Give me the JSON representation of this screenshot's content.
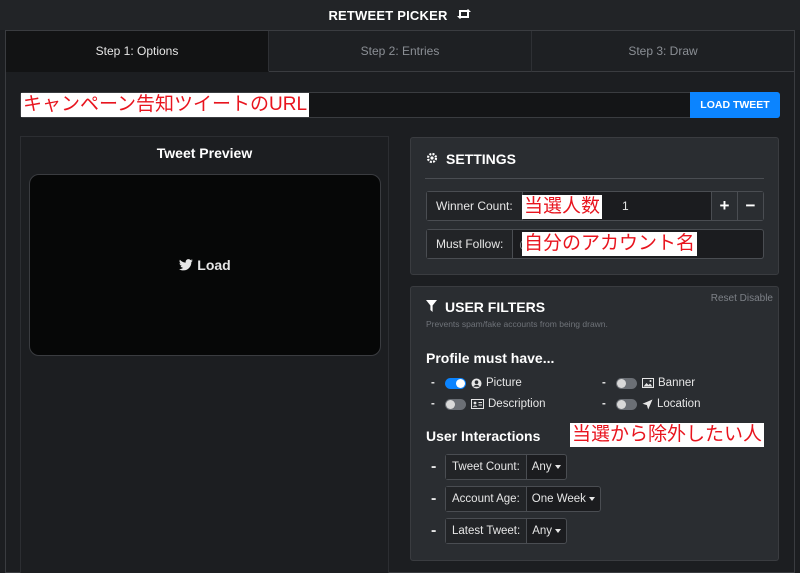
{
  "app": {
    "title": "RETWEET PICKER"
  },
  "steps": [
    "Step 1: Options",
    "Step 2: Entries",
    "Step 3: Draw"
  ],
  "url_bar": {
    "input_value": "",
    "button_label": "LOAD TWEET"
  },
  "annotations": {
    "url": "キャンペーン告知ツイートのURL",
    "winner": "当選人数",
    "follow": "自分のアカウント名",
    "exclude": "当選から除外したい人"
  },
  "preview": {
    "title": "Tweet Preview",
    "load_label": "Load"
  },
  "settings": {
    "title": "SETTINGS",
    "winner_count_label": "Winner Count:",
    "winner_count_value": "1",
    "plus": "+",
    "minus": "−",
    "must_follow_label": "Must Follow:",
    "must_follow_placeholder": "@"
  },
  "filters": {
    "title": "USER FILTERS",
    "reset_label": "Reset Disable",
    "subtitle": "Prevents spam/fake accounts from being drawn.",
    "profile_heading": "Profile must have...",
    "toggles": [
      {
        "label": "Picture",
        "on": true,
        "icon": "user-circle-icon"
      },
      {
        "label": "Banner",
        "on": false,
        "icon": "image-icon"
      },
      {
        "label": "Description",
        "on": false,
        "icon": "id-card-icon"
      },
      {
        "label": "Location",
        "on": false,
        "icon": "location-arrow-icon"
      }
    ],
    "interactions_heading": "User Interactions",
    "selects": [
      {
        "label": "Tweet Count:",
        "value": "Any"
      },
      {
        "label": "Account Age:",
        "value": "One Week"
      },
      {
        "label": "Latest Tweet:",
        "value": "Any"
      }
    ]
  },
  "colors": {
    "accent": "#0b84ff",
    "annotation": "#e8141e",
    "background": "#1c1e21",
    "panel": "#2a2d31"
  }
}
